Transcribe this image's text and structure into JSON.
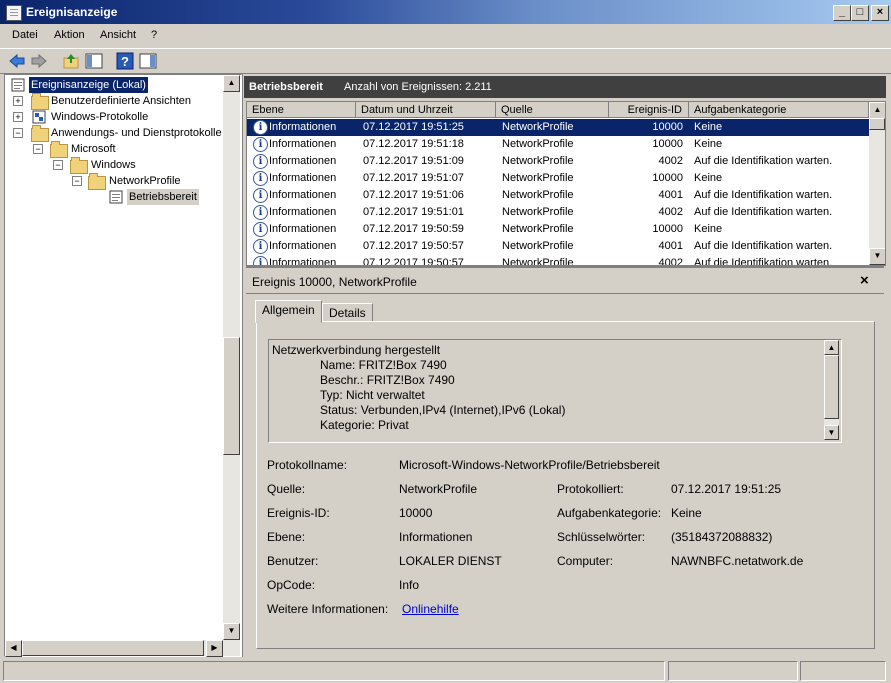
{
  "window": {
    "title": "Ereignisanzeige"
  },
  "menu": [
    "Datei",
    "Aktion",
    "Ansicht",
    "?"
  ],
  "tree": {
    "root": "Ereignisanzeige (Lokal)",
    "custom_views": "Benutzerdefinierte Ansichten",
    "windows_logs": "Windows-Protokolle",
    "app_logs": "Anwendungs- und Dienstprotokolle",
    "microsoft": "Microsoft",
    "windows": "Windows",
    "networkprofile": "NetworkProfile",
    "operational": "Betriebsbereit"
  },
  "list_header": {
    "title": "Betriebsbereit",
    "count": "Anzahl von Ereignissen: 2.211"
  },
  "columns": [
    "Ebene",
    "Datum und Uhrzeit",
    "Quelle",
    "Ereignis-ID",
    "Aufgabenkategorie"
  ],
  "events": [
    [
      "Informationen",
      "07.12.2017 19:51:25",
      "NetworkProfile",
      "10000",
      "Keine"
    ],
    [
      "Informationen",
      "07.12.2017 19:51:18",
      "NetworkProfile",
      "10000",
      "Keine"
    ],
    [
      "Informationen",
      "07.12.2017 19:51:09",
      "NetworkProfile",
      "4002",
      "Auf die Identifikation warten."
    ],
    [
      "Informationen",
      "07.12.2017 19:51:07",
      "NetworkProfile",
      "10000",
      "Keine"
    ],
    [
      "Informationen",
      "07.12.2017 19:51:06",
      "NetworkProfile",
      "4001",
      "Auf die Identifikation warten."
    ],
    [
      "Informationen",
      "07.12.2017 19:51:01",
      "NetworkProfile",
      "4002",
      "Auf die Identifikation warten."
    ],
    [
      "Informationen",
      "07.12.2017 19:50:59",
      "NetworkProfile",
      "10000",
      "Keine"
    ],
    [
      "Informationen",
      "07.12.2017 19:50:57",
      "NetworkProfile",
      "4001",
      "Auf die Identifikation warten."
    ],
    [
      "Informationen",
      "07.12.2017 19:50:57",
      "NetworkProfile",
      "4002",
      "Auf die Identifikation warten."
    ]
  ],
  "details": {
    "title": "Ereignis 10000, NetworkProfile",
    "tabs": [
      "Allgemein",
      "Details"
    ],
    "message": [
      "Netzwerkverbindung hergestellt",
      "Name: FRITZ!Box 7490",
      "Beschr.: FRITZ!Box 7490",
      "Typ: Nicht verwaltet",
      "Status: Verbunden,IPv4 (Internet),IPv6 (Lokal)",
      "Kategorie: Privat"
    ],
    "fields": {
      "protokollname_label": "Protokollname:",
      "protokollname": "Microsoft-Windows-NetworkProfile/Betriebsbereit",
      "quelle_label": "Quelle:",
      "quelle": "NetworkProfile",
      "protokolliert_label": "Protokolliert:",
      "protokolliert": "07.12.2017 19:51:25",
      "ereignis_id_label": "Ereignis-ID:",
      "ereignis_id": "10000",
      "aufgabenkategorie_label": "Aufgabenkategorie:",
      "aufgabenkategorie": "Keine",
      "ebene_label": "Ebene:",
      "ebene": "Informationen",
      "schluesselwoerter_label": "Schlüsselwörter:",
      "schluesselwoerter": "(35184372088832)",
      "benutzer_label": "Benutzer:",
      "benutzer": "LOKALER DIENST",
      "computer_label": "Computer:",
      "computer": "NAWNBFC.netatwork.de",
      "opcode_label": "OpCode:",
      "opcode": "Info",
      "weitere_label": "Weitere Informationen:",
      "weitere_link": "Onlinehilfe"
    }
  },
  "colors": {
    "selection": "#0a246a",
    "header_dark": "#404040",
    "link": "#0000cc"
  },
  "icons": {
    "info": "i"
  }
}
